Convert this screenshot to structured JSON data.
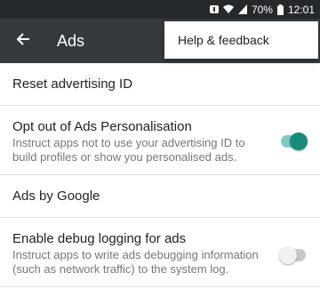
{
  "status_bar": {
    "battery_percent": "70%",
    "time": "12:01",
    "icons": [
      "notification-icon",
      "wifi-icon",
      "signal-icon",
      "battery-icon"
    ]
  },
  "app_bar": {
    "title": "Ads",
    "back_icon": "arrow-back-icon"
  },
  "overflow_menu": {
    "items": [
      {
        "label": "Help & feedback"
      }
    ]
  },
  "settings": {
    "reset_id": {
      "title": "Reset advertising ID"
    },
    "opt_out": {
      "title": "Opt out of Ads Personalisation",
      "summary": "Instruct apps not to use your advertising ID to build profiles or show you personalised ads.",
      "enabled": true
    },
    "ads_by_google": {
      "title": "Ads by Google"
    },
    "debug_logging": {
      "title": "Enable debug logging for ads",
      "summary": "Instruct apps to write ads debugging information (such as network traffic) to the system log.",
      "enabled": false
    }
  },
  "colors": {
    "status_bar": "#25292c",
    "app_bar": "#353a3e",
    "accent": "#1a8a7a"
  }
}
